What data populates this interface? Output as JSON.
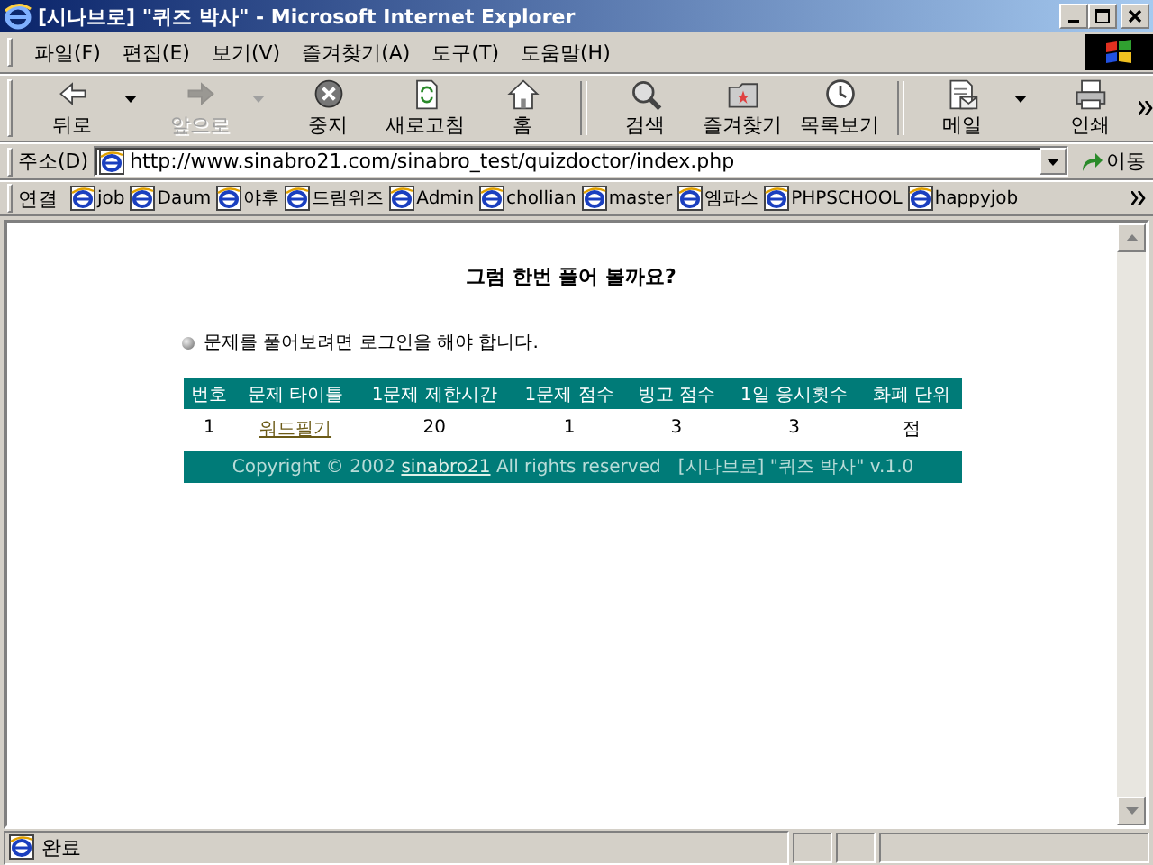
{
  "window": {
    "title": "[시나브로] \"퀴즈 박사\" - Microsoft Internet Explorer"
  },
  "menu": [
    "파일(F)",
    "편집(E)",
    "보기(V)",
    "즐겨찾기(A)",
    "도구(T)",
    "도움말(H)"
  ],
  "toolbar": [
    {
      "label": "뒤로",
      "disabled": false,
      "dropdown": true
    },
    {
      "label": "앞으로",
      "disabled": true,
      "dropdown": true
    },
    {
      "label": "중지",
      "disabled": false,
      "dropdown": false
    },
    {
      "label": "새로고침",
      "disabled": false,
      "dropdown": false
    },
    {
      "label": "홈",
      "disabled": false,
      "dropdown": false
    },
    {
      "label": "검색",
      "disabled": false,
      "dropdown": false
    },
    {
      "label": "즐겨찾기",
      "disabled": false,
      "dropdown": false
    },
    {
      "label": "목록보기",
      "disabled": false,
      "dropdown": false
    },
    {
      "label": "메일",
      "disabled": false,
      "dropdown": true
    },
    {
      "label": "인쇄",
      "disabled": false,
      "dropdown": false
    }
  ],
  "address": {
    "label": "주소(D)",
    "url": "http://www.sinabro21.com/sinabro_test/quizdoctor/index.php",
    "go": "이동"
  },
  "links": {
    "label": "연결",
    "items": [
      "job",
      "Daum",
      "야후",
      "드림위즈",
      "Admin",
      "chollian",
      "master",
      "엠파스",
      "PHPSCHOOL",
      "happyjob"
    ]
  },
  "page": {
    "heading": "그럼 한번 풀어 볼까요?",
    "notice": "문제를 풀어보려면 로그인을 해야 합니다.",
    "table": {
      "columns": [
        "번호",
        "문제 타이틀",
        "1문제 제한시간",
        "1문제 점수",
        "빙고 점수",
        "1일 응시횟수",
        "화폐 단위"
      ],
      "rows": [
        [
          {
            "kind": "text",
            "text": "1"
          },
          {
            "kind": "link",
            "text": "워드필기"
          },
          {
            "kind": "text",
            "text": "20"
          },
          {
            "kind": "text",
            "text": "1"
          },
          {
            "kind": "text",
            "text": "3"
          },
          {
            "kind": "text",
            "text": "3"
          },
          {
            "kind": "text",
            "text": "점"
          }
        ]
      ]
    },
    "footer": {
      "before": "Copyright © 2002 ",
      "link": "sinabro21",
      "after": " All rights reserved   [시나브로] \"퀴즈 박사\" v.1.0"
    }
  },
  "status_bar": {
    "text": "완료"
  }
}
